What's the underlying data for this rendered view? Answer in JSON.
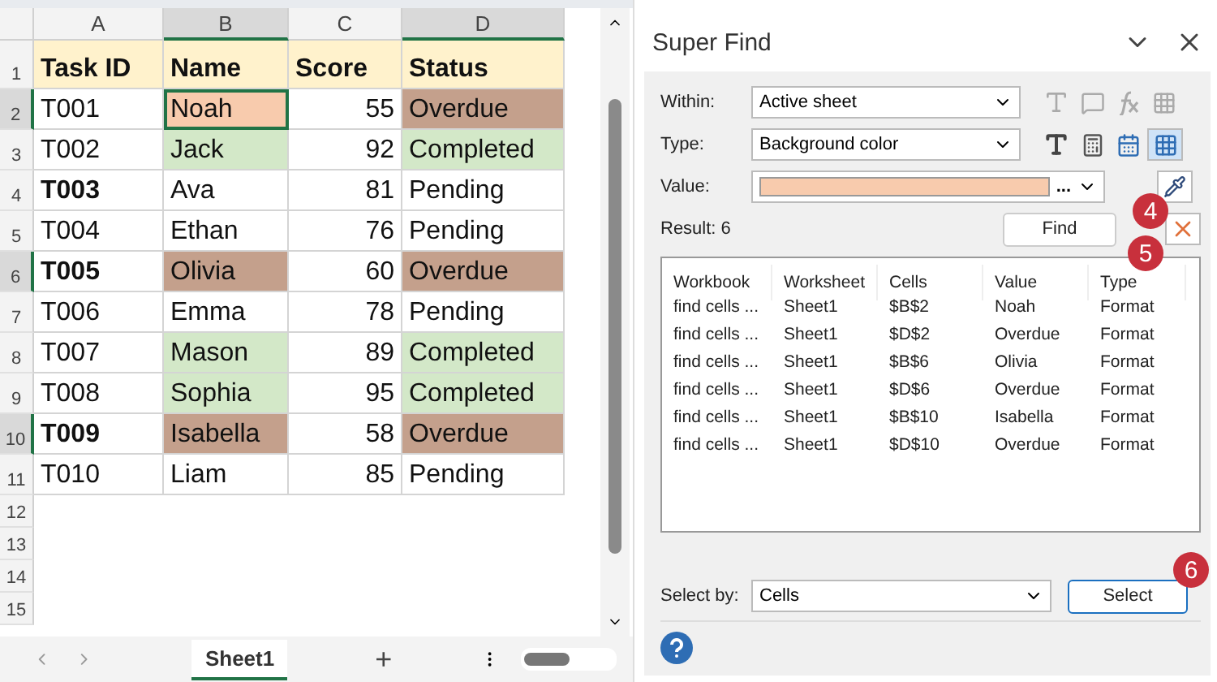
{
  "sheet": {
    "columns": [
      {
        "label": "A",
        "selected": false
      },
      {
        "label": "B",
        "selected": true
      },
      {
        "label": "C",
        "selected": false
      },
      {
        "label": "D",
        "selected": true
      }
    ],
    "rows": [
      {
        "header": "1",
        "selected": false,
        "cells": [
          {
            "text": "Task ID",
            "bold": true,
            "color": "#fff2cc"
          },
          {
            "text": "Name",
            "bold": true,
            "color": "#fff2cc"
          },
          {
            "text": "Score",
            "bold": true,
            "color": "#fff2cc"
          },
          {
            "text": "Status",
            "bold": true,
            "color": "#fff2cc"
          }
        ]
      },
      {
        "header": "2",
        "selected": true,
        "cells": [
          {
            "text": "T001"
          },
          {
            "text": "Noah",
            "color": "#f8cbad",
            "active": true
          },
          {
            "text": "55"
          },
          {
            "text": "Overdue",
            "color": "#c4a08c"
          }
        ]
      },
      {
        "header": "3",
        "selected": false,
        "cells": [
          {
            "text": "T002"
          },
          {
            "text": "Jack",
            "color": "#d3e8c8"
          },
          {
            "text": "92"
          },
          {
            "text": "Completed",
            "color": "#d3e8c8"
          }
        ]
      },
      {
        "header": "4",
        "selected": false,
        "cells": [
          {
            "text": "T003",
            "bold": true
          },
          {
            "text": "Ava"
          },
          {
            "text": "81"
          },
          {
            "text": "Pending"
          }
        ]
      },
      {
        "header": "5",
        "selected": false,
        "cells": [
          {
            "text": "T004"
          },
          {
            "text": "Ethan"
          },
          {
            "text": "76"
          },
          {
            "text": "Pending"
          }
        ]
      },
      {
        "header": "6",
        "selected": true,
        "cells": [
          {
            "text": "T005",
            "bold": true
          },
          {
            "text": "Olivia",
            "color": "#c4a08c"
          },
          {
            "text": "60"
          },
          {
            "text": "Overdue",
            "color": "#c4a08c"
          }
        ]
      },
      {
        "header": "7",
        "selected": false,
        "cells": [
          {
            "text": "T006"
          },
          {
            "text": "Emma"
          },
          {
            "text": "78"
          },
          {
            "text": "Pending"
          }
        ]
      },
      {
        "header": "8",
        "selected": false,
        "cells": [
          {
            "text": "T007"
          },
          {
            "text": "Mason",
            "color": "#d3e8c8"
          },
          {
            "text": "89"
          },
          {
            "text": "Completed",
            "color": "#d3e8c8"
          }
        ]
      },
      {
        "header": "9",
        "selected": false,
        "cells": [
          {
            "text": "T008"
          },
          {
            "text": "Sophia",
            "color": "#d3e8c8"
          },
          {
            "text": "95"
          },
          {
            "text": "Completed",
            "color": "#d3e8c8"
          }
        ]
      },
      {
        "header": "10",
        "selected": true,
        "cells": [
          {
            "text": "T009",
            "bold": true
          },
          {
            "text": "Isabella",
            "color": "#c4a08c"
          },
          {
            "text": "58"
          },
          {
            "text": "Overdue",
            "color": "#c4a08c"
          }
        ]
      },
      {
        "header": "11",
        "selected": false,
        "cells": [
          {
            "text": "T010"
          },
          {
            "text": "Liam"
          },
          {
            "text": "85"
          },
          {
            "text": "Pending"
          }
        ]
      }
    ],
    "empty_rows": [
      "12",
      "13",
      "14",
      "15"
    ],
    "tabs": [
      {
        "label": "Sheet1",
        "selected": true
      },
      {
        "label": "+",
        "selected": false
      }
    ]
  },
  "panel": {
    "title": "Super Find",
    "within": {
      "label": "Within:",
      "value": "Active sheet"
    },
    "type": {
      "label": "Type:",
      "value": "Background color"
    },
    "value": {
      "label": "Value:",
      "color": "#f8cbad",
      "more": "..."
    },
    "result": "Result: 6",
    "find_button": "Find",
    "results": {
      "columns": [
        "Workbook",
        "Worksheet",
        "Cells",
        "Value",
        "Type"
      ],
      "rows": [
        [
          "find cells ...",
          "Sheet1",
          "$B$2",
          "Noah",
          "Format"
        ],
        [
          "find cells ...",
          "Sheet1",
          "$D$2",
          "Overdue",
          "Format"
        ],
        [
          "find cells ...",
          "Sheet1",
          "$B$6",
          "Olivia",
          "Format"
        ],
        [
          "find cells ...",
          "Sheet1",
          "$D$6",
          "Overdue",
          "Format"
        ],
        [
          "find cells ...",
          "Sheet1",
          "$B$10",
          "Isabella",
          "Format"
        ],
        [
          "find cells ...",
          "Sheet1",
          "$D$10",
          "Overdue",
          "Format"
        ]
      ]
    },
    "select_by": {
      "label": "Select by:",
      "value": "Cells"
    },
    "select_button": "Select",
    "badges": [
      "4",
      "5",
      "6"
    ]
  }
}
